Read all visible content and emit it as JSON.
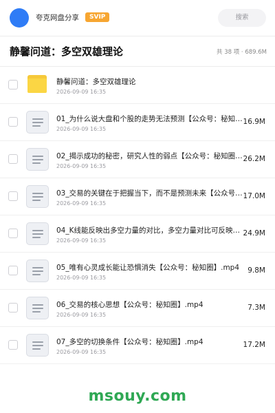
{
  "header": {
    "share_title": "夸克网盘分享",
    "badge": "SVIP",
    "search_placeholder": "搜索"
  },
  "folder": {
    "title": "静馨问道：多空双雄理论",
    "summary": "共 38 项 · 689.6M"
  },
  "files": [
    {
      "type": "folder",
      "name": "静馨问道：多空双雄理论",
      "date": "2026-09-09 16:35",
      "size": ""
    },
    {
      "type": "file",
      "name": "01_为什么说大盘和个股的走势无法预测【公众号：秘知圈】.mp4",
      "date": "2026-09-09 16:35",
      "size": "16.9M"
    },
    {
      "type": "file",
      "name": "02_揭示成功的秘密，研究人性的弱点【公众号：秘知圈】.mp4",
      "date": "2026-09-09 16:35",
      "size": "26.2M"
    },
    {
      "type": "file",
      "name": "03_交易的关键在于把握当下，而不是预测未来【公众号：秘知圈】.mp4",
      "date": "2026-09-09 16:35",
      "size": "17.0M"
    },
    {
      "type": "file",
      "name": "04_K线能反映出多空力量的对比，多空力量对比可反映趋势.mp4",
      "date": "2026-09-09 16:35",
      "size": "24.9M"
    },
    {
      "type": "file",
      "name": "05_唯有心灵成长能让恐惧消失【公众号：秘知圈】.mp4",
      "date": "2026-09-09 16:35",
      "size": "9.8M"
    },
    {
      "type": "file",
      "name": "06_交易的核心思想【公众号：秘知圈】.mp4",
      "date": "2026-09-09 16:35",
      "size": "7.3M"
    },
    {
      "type": "file",
      "name": "07_多空的切换条件【公众号：秘知圈】.mp4",
      "date": "2026-09-09 16:35",
      "size": "17.2M"
    }
  ],
  "watermark": "msouy.com",
  "colors": {
    "avatar": "#2f7cf6",
    "badge": "#f7a631",
    "folder": "#fbd644",
    "watermark": "#2fa854"
  }
}
